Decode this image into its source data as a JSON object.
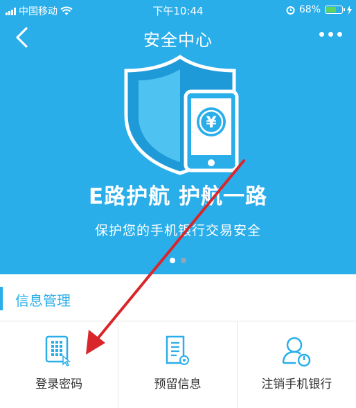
{
  "status_bar": {
    "carrier": "中国移动",
    "time": "下午10:44",
    "battery": "68%",
    "battery_level": 0.68
  },
  "nav": {
    "title": "安全中心"
  },
  "banner": {
    "slogan": "E路护航 护航一路",
    "subtitle": "保护您的手机银行交易安全",
    "currency_symbol": "¥",
    "pages": 2,
    "active_page": 1
  },
  "section": {
    "title": "信息管理"
  },
  "grid": {
    "items": [
      {
        "label": "登录密码",
        "icon": "keypad-icon"
      },
      {
        "label": "预留信息",
        "icon": "document-icon"
      },
      {
        "label": "注销手机银行",
        "icon": "user-power-icon"
      }
    ]
  },
  "colors": {
    "primary": "#2aaeea",
    "annotation_arrow": "#d8262b"
  }
}
